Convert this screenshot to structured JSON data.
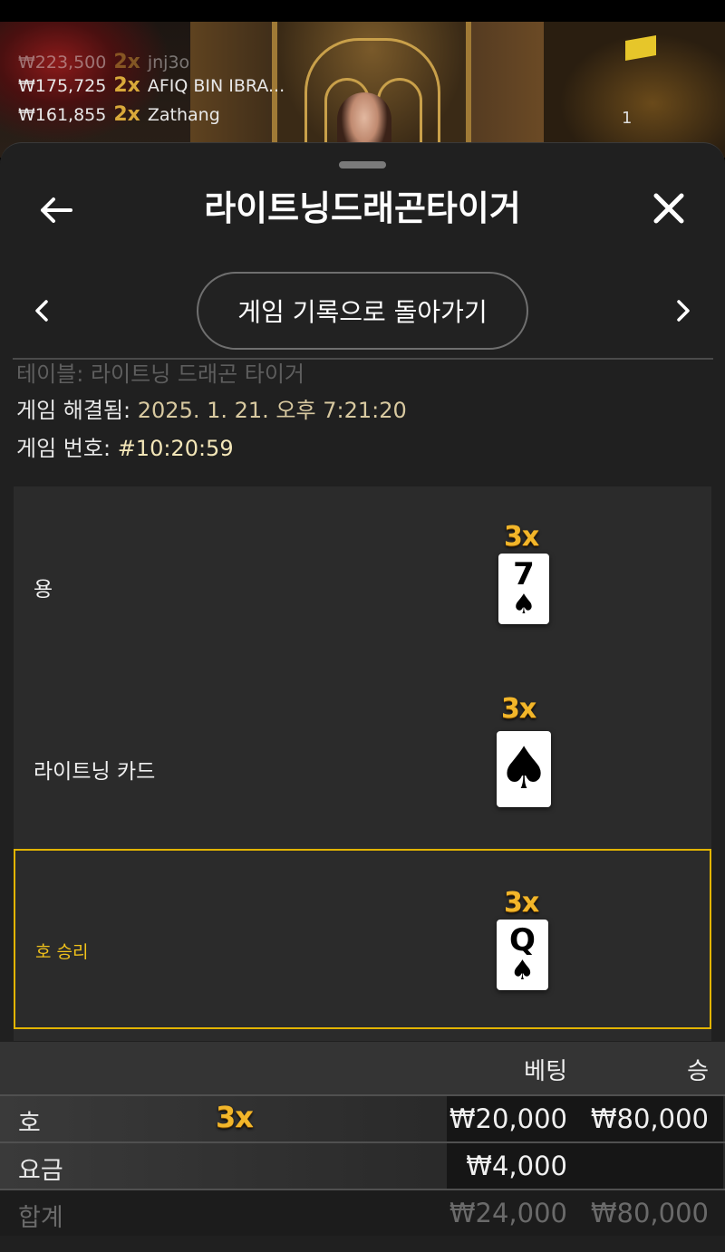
{
  "background": {
    "winners": [
      {
        "amount": "₩223,500",
        "multiplier": "2x",
        "name": "jnj3o"
      },
      {
        "amount": "₩175,725",
        "multiplier": "2x",
        "name": "AFIQ BIN IBRA..."
      },
      {
        "amount": "₩161,855",
        "multiplier": "2x",
        "name": "Zathang"
      }
    ],
    "count": "1",
    "colors": {
      "multiplier": "#d9a93a"
    }
  },
  "header": {
    "title": "라이트닝드래곤타이거",
    "back_icon": "arrow-left-icon",
    "close_icon": "close-icon"
  },
  "nav": {
    "history_button": "게임 기록으로 돌아가기",
    "prev_icon": "chevron-left-icon",
    "next_icon": "chevron-right-icon"
  },
  "info": {
    "table_label": "테이블: 라이트닝 드래곤 타이거",
    "resolved_label": "게임 해결됨:",
    "resolved_value": "2025. 1. 21. 오후 7:21:20",
    "game_no_label": "게임 번호:",
    "game_no_value": "#10:20:59"
  },
  "results": [
    {
      "label": "용",
      "multiplier": "3x",
      "card_rank": "7",
      "card_suit": "♠"
    },
    {
      "label": "라이트닝 카드",
      "multiplier": "3x",
      "card_rank": "",
      "card_suit": "♠"
    },
    {
      "label": "호 승리",
      "multiplier": "3x",
      "card_rank": "Q",
      "card_suit": "♠",
      "highlighted": true
    }
  ],
  "table": {
    "headers": {
      "bet": "베팅",
      "win": "승"
    },
    "rows": [
      {
        "label": "호",
        "multiplier": "3x",
        "bet": "₩20,000",
        "win": "₩80,000"
      },
      {
        "label": "요금",
        "bet": "₩4,000",
        "win": ""
      },
      {
        "label": "합계",
        "bet": "₩24,000",
        "win": "₩80,000"
      }
    ]
  },
  "colors": {
    "sheet_bg": "#202020",
    "accent_gold": "#f2b62a",
    "winner_border": "#e2b400",
    "winner_text": "#f1c21b"
  }
}
